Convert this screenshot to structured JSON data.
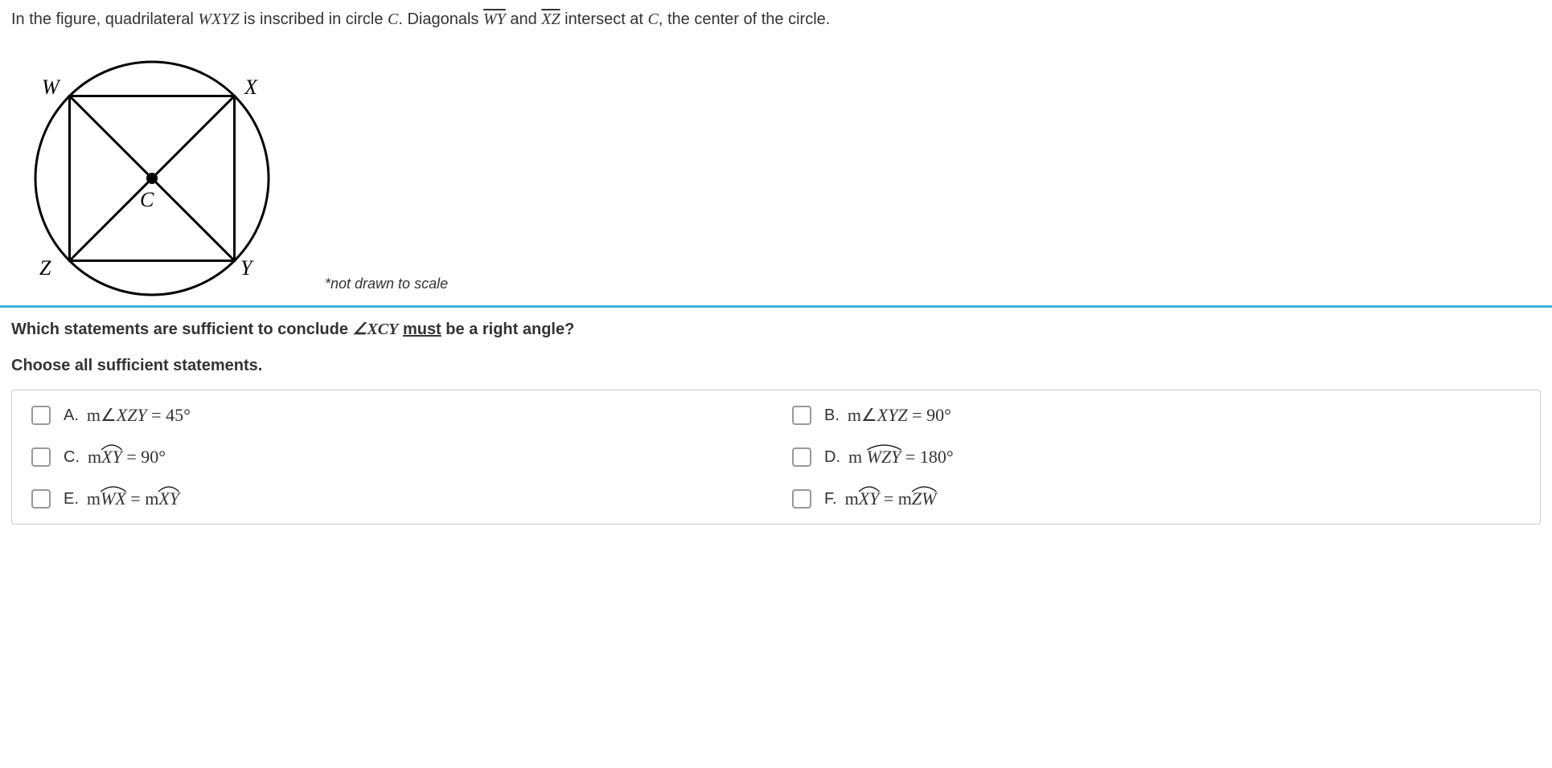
{
  "intro": {
    "prefix": "In the figure, quadrilateral ",
    "quad": "WXYZ",
    "mid1": " is inscribed in circle ",
    "circ": "C",
    "mid2": ". Diagonals ",
    "diag1": "WY",
    "and": " and ",
    "diag2": "XZ",
    "mid3": " intersect at ",
    "center": "C",
    "suffix": ", the center of the circle."
  },
  "figure": {
    "labels": {
      "W": "W",
      "X": "X",
      "Y": "Y",
      "Z": "Z",
      "C": "C"
    }
  },
  "scale_note": "*not drawn to scale",
  "question": {
    "prefix": "Which statements are sufficient to conclude ",
    "angle_symbol": "∠",
    "angle": "XCY",
    "suffix1": " ",
    "must": "must",
    "suffix2": " be a right angle?"
  },
  "instruction": {
    "prefix": "Choose ",
    "all": "all",
    "suffix": " sufficient statements."
  },
  "options": {
    "A": {
      "letter": "A.",
      "prefix": "m∠",
      "var": "XZY",
      "eq": " = 45°"
    },
    "B": {
      "letter": "B.",
      "prefix": "m∠",
      "var": "XYZ",
      "eq": " = 90°"
    },
    "C": {
      "letter": "C.",
      "prefix": "m",
      "arc": "XY",
      "eq": " = 90°"
    },
    "D": {
      "letter": "D.",
      "prefix": "m ",
      "arc": "WZY",
      "eq": " = 180°"
    },
    "E": {
      "letter": "E.",
      "prefix_l": "m",
      "arc_l": "WX",
      "mid": " = m",
      "arc_r": "XY"
    },
    "F": {
      "letter": "F.",
      "prefix_l": "m",
      "arc_l": "XY",
      "mid": " = m",
      "arc_r": "ZW"
    }
  }
}
